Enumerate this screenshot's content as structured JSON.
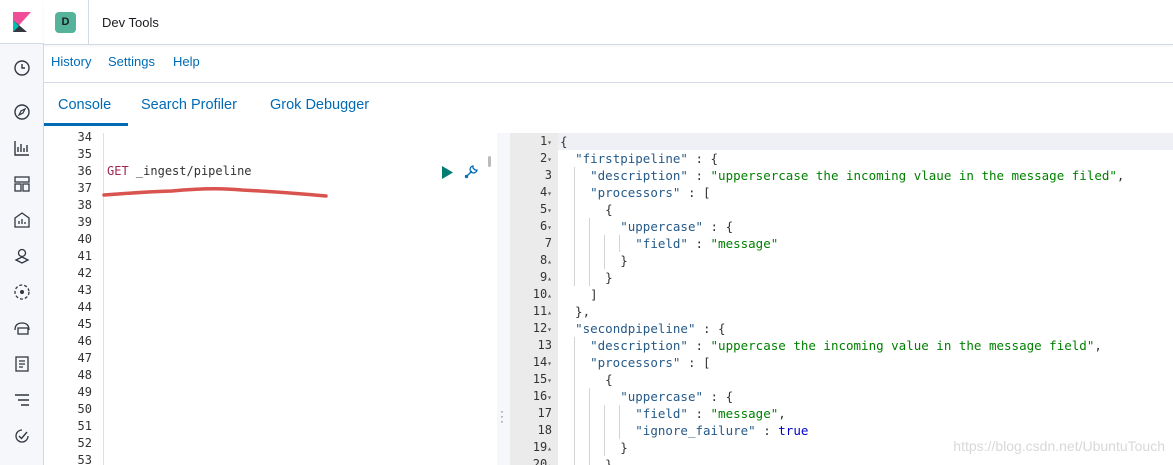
{
  "header": {
    "space_initial": "D",
    "app_title": "Dev Tools"
  },
  "menu": {
    "items": [
      "History",
      "Settings",
      "Help"
    ]
  },
  "tabs": [
    {
      "label": "Console",
      "active": true
    },
    {
      "label": "Search Profiler",
      "active": false
    },
    {
      "label": "Grok Debugger",
      "active": false
    }
  ],
  "request": {
    "line_numbers": [
      "34",
      "35",
      "36",
      "37",
      "38",
      "39",
      "40",
      "41",
      "42",
      "43",
      "44",
      "45",
      "46",
      "47",
      "48",
      "49",
      "50",
      "51",
      "52",
      "53"
    ],
    "method": "GET",
    "path": "_ingest/pipeline"
  },
  "response": {
    "line_numbers": [
      "1",
      "2",
      "3",
      "4",
      "5",
      "6",
      "7",
      "8",
      "9",
      "10",
      "11",
      "12",
      "13",
      "14",
      "15",
      "16",
      "17",
      "18",
      "19",
      "20"
    ],
    "lines": [
      "{",
      "  \"firstpipeline\" : {",
      "    \"description\" : \"uppersercase the incoming vlaue in the message filed\",",
      "    \"processors\" : [",
      "      {",
      "        \"uppercase\" : {",
      "          \"field\" : \"message\"",
      "        }",
      "      }",
      "    ]",
      "  },",
      "  \"secondpipeline\" : {",
      "    \"description\" : \"uppercase the incoming value in the message field\",",
      "    \"processors\" : [",
      "      {",
      "        \"uppercase\" : {",
      "          \"field\" : \"message\",",
      "          \"ignore_failure\" : true",
      "        }",
      "      }"
    ]
  },
  "watermark": "https://blog.csdn.net/UbuntuTouch",
  "colors": {
    "link": "#006bb4",
    "avatar": "#54b399",
    "get_method": "#a0274d",
    "json_key": "#265a88",
    "json_string": "#008000",
    "json_bool": "#0000c8"
  }
}
